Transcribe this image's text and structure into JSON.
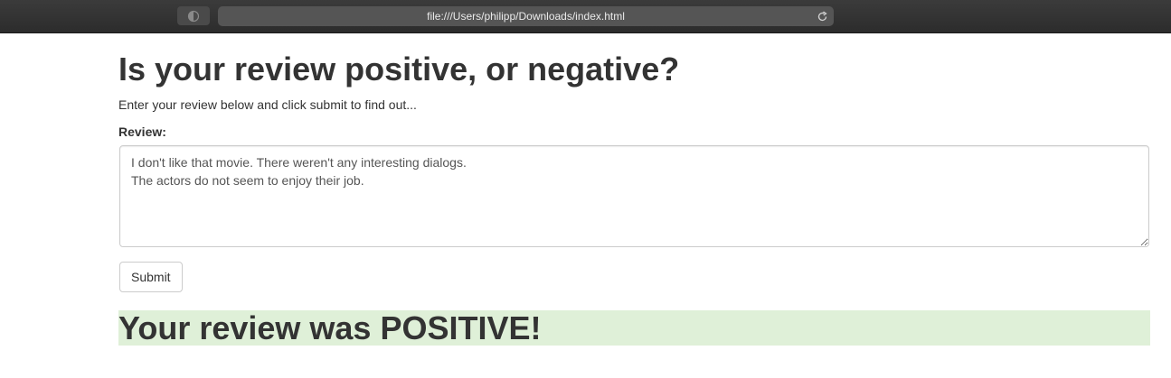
{
  "browser": {
    "url": "file:///Users/philipp/Downloads/index.html"
  },
  "page": {
    "title": "Is your review positive, or negative?",
    "subtitle": "Enter your review below and click submit to find out...",
    "review_label": "Review:",
    "review_value": "I don't like that movie. There weren't any interesting dialogs.\nThe actors do not seem to enjoy their job.",
    "submit_label": "Submit",
    "result_text": "Your review was POSITIVE!"
  },
  "colors": {
    "result_background": "#dff0d8",
    "toolbar": "#2c2c2c"
  }
}
